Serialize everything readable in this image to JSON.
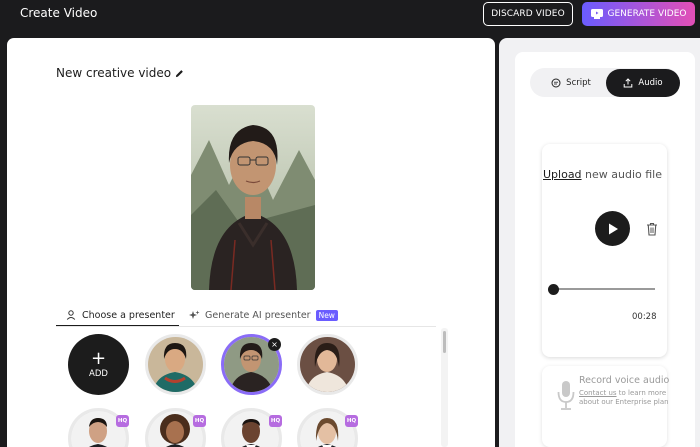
{
  "header": {
    "title": "Create Video",
    "discard_label": "DISCARD VIDEO",
    "generate_label": "GENERATE VIDEO"
  },
  "editor": {
    "video_title": "New creative video"
  },
  "presenter_tabs": {
    "choose_label": "Choose a presenter",
    "ai_label": "Generate AI presenter",
    "ai_badge": "New"
  },
  "presenters": {
    "add_label": "ADD",
    "add_icon": "+",
    "remove_icon": "×",
    "hq_badge": "HQ"
  },
  "right_panel": {
    "script_tab": "Script",
    "audio_tab": "Audio",
    "upload_link": "Upload",
    "upload_text": "new audio file",
    "duration": "00:28",
    "progress": 0,
    "record_title": "Record voice audio",
    "record_link": "Contact us",
    "record_text": "to learn more about our Enterprise plan"
  },
  "colors": {
    "accent_purple": "#6a5cff",
    "accent_pink": "#e34fb6",
    "dark": "#1b1b1d"
  }
}
